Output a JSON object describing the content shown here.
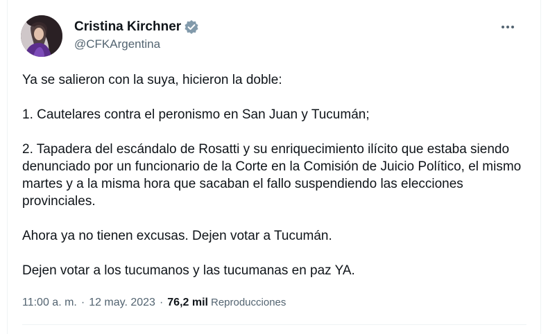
{
  "author": {
    "name": "Cristina Kirchner",
    "handle": "@CFKArgentina",
    "verified": true,
    "avatar_icon": "profile-photo"
  },
  "tweet": {
    "paragraphs": [
      "Ya se salieron con la suya, hicieron la doble:",
      "1. Cautelares contra el peronismo en San Juan y Tucumán;",
      "2. Tapadera del escándalo de Rosatti y su enriquecimiento ilícito que estaba siendo denunciado por un funcionario de la Corte en la Comisión de Juicio Político, el mismo martes y a la misma hora que sacaban el fallo suspendiendo las elecciones provinciales.",
      "Ahora ya no tienen excusas. Dejen votar a Tucumán.",
      "Dejen votar a los tucumanos y las tucumanas en paz YA."
    ]
  },
  "meta": {
    "time": "11:00 a. m.",
    "separator": "·",
    "date": "12 may. 2023",
    "views_count": "76,2 mil",
    "views_label": "Reproducciones"
  },
  "colors": {
    "text": "#0f1419",
    "secondary": "#536471",
    "verified_badge": "#1d9bf0"
  }
}
